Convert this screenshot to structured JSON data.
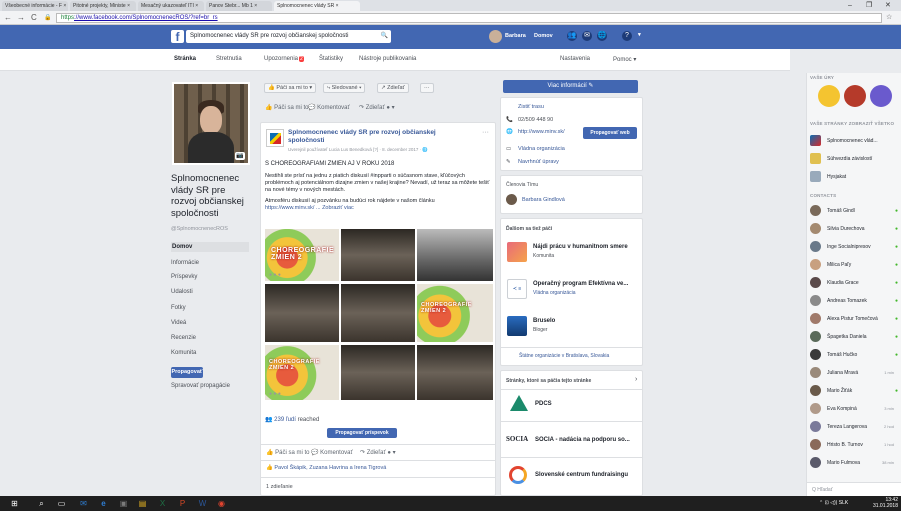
{
  "browser": {
    "tabs": [
      {
        "label": "Všeobecné informácie - F ×"
      },
      {
        "label": "Pitotné projekty, Ministe ×"
      },
      {
        "label": "Mesačný ukazovateľ ITI ×"
      },
      {
        "label": "Panov Stebr... Mb 1 ×"
      },
      {
        "label": "Splnomocnenec vlády SR ×"
      }
    ],
    "url_secure": "https",
    "url_rest": "://www.facebook.com/SplnomocnenecROS/?ref=br_rs",
    "window_controls": {
      "minimize": "–",
      "maximize": "❐",
      "close": "✕"
    }
  },
  "fb": {
    "logo": "f",
    "search_value": "Splnomocnenec vlády SR pre rozvoj občianskej spoločnosti",
    "user_name": "Barbara",
    "nav_home": "Domov"
  },
  "page_tabs": [
    {
      "label": "Stránka",
      "active": true
    },
    {
      "label": "Stretnutia"
    },
    {
      "label": "Upozornenia",
      "badge": "2"
    },
    {
      "label": "Štatistiky"
    },
    {
      "label": "Nástroje publikovania"
    }
  ],
  "page_tabs_right": {
    "settings": "Nastavenia",
    "help": "Pomoc ▾"
  },
  "page": {
    "name": "Splnomocnenec vlády SR pre rozvoj občianskej spoločnosti",
    "handle": "@SplnomocnenecROS",
    "nav": [
      "Domov",
      "Informácie",
      "Príspevky",
      "Udalosti",
      "Fotky",
      "Videá",
      "Recenzie",
      "Komunita"
    ],
    "promote": "Propagovať",
    "manage_promotions": "Spravovať propagácie"
  },
  "actions_bar": {
    "like": "Páči sa mi to ▾",
    "follow": "Sledované ▾",
    "share": "Zdieľať",
    "more": "···"
  },
  "actions_row": {
    "like": "Páči sa mi to",
    "comment": "Komentovať",
    "share": "Zdieľať"
  },
  "post": {
    "author": "Splnomocnenec vlády SR pre rozvoj občianskej spoločnosti",
    "meta": "Uverejnil používateľ Lucia Lus Benedková [?] · 8. december 2017 · 🌐",
    "headline": "S CHOREOGRAFIAMI ZMIEN AJ V ROKU 2018",
    "body1": "Nestihli ste prísť na jednu z piatich diskusií #inpparti o súčasnom stave, kľúčových problémoch aj potenciálnom dizajne zmien v našej krajine? Nevadí, už teraz sa môžete tešiť na nové témy v nových mestách.",
    "body2": "Atmosféru diskusií aj pozvánku na budúci rok nájdete v našom článku",
    "link": "https://www.minv.sk/",
    "see_more": "... Zobraziť viac",
    "photo_title": "CHOREOGRAFIE ZMIEN 2",
    "reach_count": "239 ľudí",
    "reach_label": "reached",
    "boost": "Propagovať príspevok",
    "likers": "Pavol Škápik, Zuzana Havrina a Irena Tigrová",
    "shares": "1 zdieľanie"
  },
  "info": {
    "more_info": "Viac informácií ✎",
    "lines": [
      "Zistiť trasu",
      "02/509 448 90",
      "http://www.minv.sk/",
      "Vládna organizácia",
      "Navrhnúť úpravy"
    ],
    "web_button": "Propagovať web",
    "team_title": "Členovia Tímu",
    "team_member": "Barbara Gindlová",
    "maylike": "Ďalšom sa tiež páči",
    "suggestions": [
      {
        "name": "Nájdi prácu v humanitnom smere",
        "type": "Komunita"
      },
      {
        "name": "Operačný program Efektívna ve...",
        "type": "Vládna organizácia"
      },
      {
        "name": "Bruselo",
        "type": "Bloger"
      }
    ],
    "state_orgs": "Štátne organizácie v Bratislava, Slovakia",
    "liked_by_page": "Stránky, ktoré sa páčia tejto stránke",
    "liked_pages": [
      "PDCS",
      "SOCIA - nadácia na podporu so...",
      "Slovenské centrum fundraisingu"
    ],
    "socia_logo": "SOCIA"
  },
  "chat": {
    "your_pages": "VAŠE ÚRY",
    "see_all": "VAŠE STRÁNKY ZOBRAZIŤ VŠETKO",
    "contacts_title": "CONTACTS",
    "pages": [
      {
        "name": "Splnomocnenec vlád..."
      },
      {
        "name": "Súhvezdia závislostí"
      },
      {
        "name": "Hysjakat"
      }
    ],
    "contacts": [
      {
        "name": "Tomáš Gindl",
        "status": "●"
      },
      {
        "name": "Silvia Durechova",
        "status": "●"
      },
      {
        "name": "Inge Socialnipresov",
        "status": "●"
      },
      {
        "name": "Milica Paľy",
        "status": "●"
      },
      {
        "name": "Klaudia Grace",
        "status": "●"
      },
      {
        "name": "Andreas Tomazek",
        "status": "●"
      },
      {
        "name": "Alexa Pistur Tomečová",
        "status": "●"
      },
      {
        "name": "Špagetka Daniela",
        "status": "●"
      },
      {
        "name": "Tomáš Hučko",
        "status": "●"
      },
      {
        "name": "Juliana Mravá",
        "time": "1 min"
      },
      {
        "name": "Mario Žiťák",
        "status": "●"
      },
      {
        "name": "Eva Kompiná",
        "time": "3 min"
      },
      {
        "name": "Tereza Langerova",
        "time": "2 hod"
      },
      {
        "name": "Hristo B. Turnov",
        "time": "1 hod"
      },
      {
        "name": "Mario Fulmova",
        "time": "38 min"
      }
    ],
    "search_placeholder": "Q Hľadať"
  },
  "taskbar": {
    "clock_time": "13:42",
    "clock_date": "31.01.2018",
    "lang": "SLK"
  }
}
